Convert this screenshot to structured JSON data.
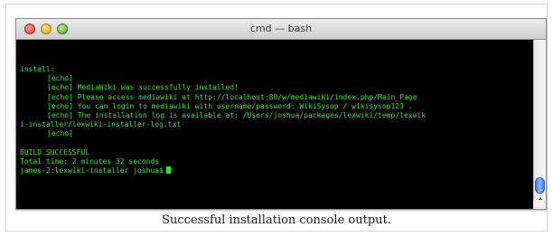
{
  "window": {
    "title": "cmd — bash"
  },
  "terminal": {
    "lines": [
      "install:",
      "[echo]",
      "[echo] MediaWiki was successfully installed!",
      "[echo] Please access mediawiki at http://localhost:80/w/mediawiki/index.php/Main_Page",
      "[echo] You can login to mediawiki with username/password: WikiSysop / wikisysop123 .",
      "[echo] The installation log is available at: /Users/joshua/packages/lexwiki/temp/lexwik",
      "i-installer/lexwiki-installer-log.txt",
      "[echo]",
      "",
      "BUILD SUCCESSFUL",
      "Total time: 2 minutes 32 seconds",
      "james-2:lexwiki-installer joshua$"
    ]
  },
  "caption": "Successful installation console output.",
  "colors": {
    "terminal_background": "#000000",
    "terminal_text": "#32e632",
    "close_button": "#d93d31",
    "minimize_button": "#e0a21a",
    "zoom_button": "#4da82b",
    "scroll_thumb": "#3d7fe0"
  },
  "icons": {
    "close": "close-window-icon",
    "minimize": "minimize-window-icon",
    "zoom": "zoom-window-icon",
    "scroll_up": "scroll-up-arrow-icon",
    "scroll_down": "scroll-down-arrow-icon"
  }
}
